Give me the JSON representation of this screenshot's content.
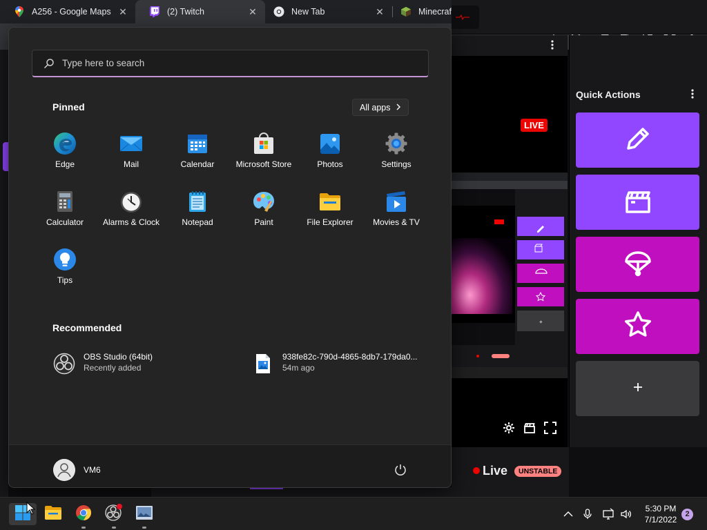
{
  "browser": {
    "tabs": [
      {
        "title": "A256 - Google Maps",
        "icon": "google-maps-icon"
      },
      {
        "title": "(2) Twitch",
        "icon": "twitch-icon"
      },
      {
        "title": "New Tab",
        "icon": "chrome-icon"
      },
      {
        "title": "Minecraft Free Trial | M",
        "icon": "minecraft-icon"
      }
    ],
    "window_controls": {
      "chevron": "⌄",
      "minimize": "—",
      "restore": "❐",
      "close": "✕"
    }
  },
  "twitch": {
    "notification_count": "2",
    "live_tag": "LIVE",
    "quick_actions": {
      "title": "Quick Actions",
      "tiles": [
        {
          "icon": "pencil-icon",
          "color": "#9147ff"
        },
        {
          "icon": "clapperboard-icon",
          "color": "#9147ff"
        },
        {
          "icon": "parachute-icon",
          "color": "#bf0fbf"
        },
        {
          "icon": "star-icon",
          "color": "#bf0fbf"
        },
        {
          "icon": "plus-icon",
          "color": "#3a3a3d"
        }
      ]
    },
    "status": {
      "live": "Live",
      "badge": "UNSTABLE"
    }
  },
  "start_menu": {
    "search_placeholder": "Type here to search",
    "pinned_heading": "Pinned",
    "all_apps_label": "All apps",
    "pinned_apps": [
      {
        "label": "Edge",
        "icon": "edge-icon"
      },
      {
        "label": "Mail",
        "icon": "mail-icon"
      },
      {
        "label": "Calendar",
        "icon": "calendar-icon"
      },
      {
        "label": "Microsoft Store",
        "icon": "store-icon"
      },
      {
        "label": "Photos",
        "icon": "photos-icon"
      },
      {
        "label": "Settings",
        "icon": "settings-icon"
      },
      {
        "label": "Calculator",
        "icon": "calculator-icon"
      },
      {
        "label": "Alarms & Clock",
        "icon": "alarm-clock-icon"
      },
      {
        "label": "Notepad",
        "icon": "notepad-icon"
      },
      {
        "label": "Paint",
        "icon": "paint-icon"
      },
      {
        "label": "File Explorer",
        "icon": "folder-icon"
      },
      {
        "label": "Movies & TV",
        "icon": "movies-icon"
      },
      {
        "label": "Tips",
        "icon": "tips-icon"
      }
    ],
    "recommended_heading": "Recommended",
    "recommended": [
      {
        "name": "OBS Studio (64bit)",
        "sub": "Recently added",
        "icon": "obs-icon"
      },
      {
        "name": "938fe82c-790d-4865-8db7-179da0...",
        "sub": "54m ago",
        "icon": "image-file-icon"
      }
    ],
    "user_name": "VM6"
  },
  "taskbar": {
    "apps": [
      {
        "icon": "windows-start-icon"
      },
      {
        "icon": "file-explorer-icon"
      },
      {
        "icon": "chrome-icon"
      },
      {
        "icon": "obs-icon"
      },
      {
        "icon": "photo-viewer-icon"
      }
    ],
    "time": "5:30 PM",
    "date": "7/1/2022",
    "notification_count": "2"
  }
}
